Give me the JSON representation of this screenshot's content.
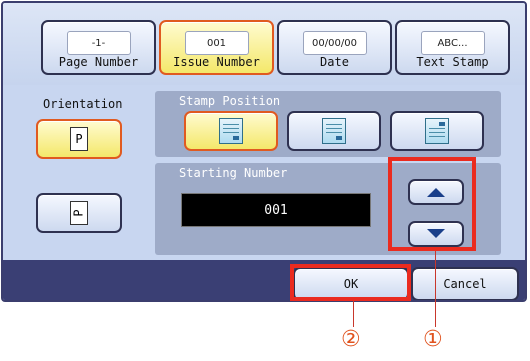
{
  "tabs": [
    {
      "chip": "-1-",
      "label": "Page Number",
      "selected": false
    },
    {
      "chip": "001",
      "label": "Issue Number",
      "selected": true
    },
    {
      "chip": "00/00/00",
      "label": "Date",
      "selected": false
    },
    {
      "chip": "ABC...",
      "label": "Text Stamp",
      "selected": false
    }
  ],
  "orientation": {
    "label": "Orientation",
    "portrait": "P",
    "landscape": "P"
  },
  "stamp_position": {
    "title": "Stamp Position"
  },
  "starting_number": {
    "title": "Starting Number",
    "value": "001"
  },
  "footer": {
    "ok_label": "OK",
    "cancel_label": "Cancel"
  },
  "callouts": {
    "ok": "②",
    "arrows": "①"
  },
  "colors": {
    "highlight": "#ea2b1f",
    "selected_fill": "#f4e86a",
    "bottom_bar": "#3a3f74"
  }
}
